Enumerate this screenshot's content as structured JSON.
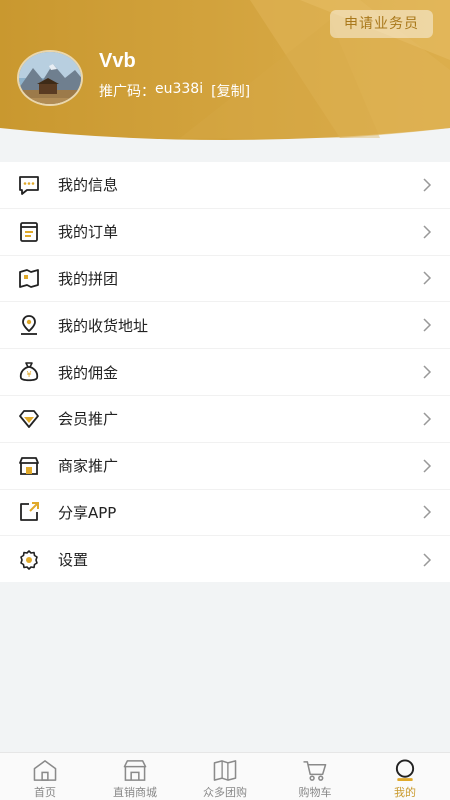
{
  "header": {
    "apply_button": "申请业务员",
    "username": "Vvb",
    "promo_label": "推广码：",
    "promo_code": "eu338i",
    "copy_label": "[复制]"
  },
  "menu": {
    "items": [
      {
        "label": "我的信息",
        "icon": "message-icon"
      },
      {
        "label": "我的订单",
        "icon": "order-icon"
      },
      {
        "label": "我的拼团",
        "icon": "group-buy-icon"
      },
      {
        "label": "我的收货地址",
        "icon": "address-pin-icon"
      },
      {
        "label": "我的佣金",
        "icon": "money-bag-icon"
      },
      {
        "label": "会员推广",
        "icon": "diamond-icon"
      },
      {
        "label": "商家推广",
        "icon": "store-icon"
      },
      {
        "label": "分享APP",
        "icon": "share-icon"
      },
      {
        "label": "设置",
        "icon": "gear-icon"
      }
    ]
  },
  "tabbar": {
    "items": [
      {
        "label": "首页",
        "icon": "home-icon",
        "active": false
      },
      {
        "label": "直销商城",
        "icon": "store-icon",
        "active": false
      },
      {
        "label": "众多团购",
        "icon": "group-buy-icon",
        "active": false
      },
      {
        "label": "购物车",
        "icon": "cart-icon",
        "active": false
      },
      {
        "label": "我的",
        "icon": "profile-icon",
        "active": true
      }
    ]
  },
  "colors": {
    "gold_dark": "#c99a2e",
    "gold_light": "#e2b655",
    "icon_accent": "#e0a92a"
  }
}
